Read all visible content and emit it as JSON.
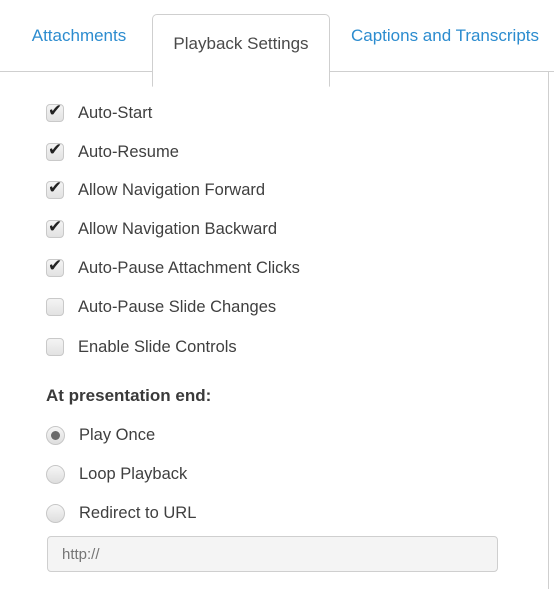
{
  "tabs": [
    {
      "label": "Attachments",
      "active": false
    },
    {
      "label": "Playback Settings",
      "active": true
    },
    {
      "label": "Captions and Transcripts",
      "active": false
    }
  ],
  "options": [
    {
      "label": "Auto-Start",
      "checked": true
    },
    {
      "label": "Auto-Resume",
      "checked": true
    },
    {
      "label": "Allow Navigation Forward",
      "checked": true
    },
    {
      "label": "Allow Navigation Backward",
      "checked": true
    },
    {
      "label": "Auto-Pause Attachment Clicks",
      "checked": true
    },
    {
      "label": "Auto-Pause Slide Changes",
      "checked": false
    },
    {
      "label": "Enable Slide Controls",
      "checked": false
    }
  ],
  "presentation_end": {
    "title": "At presentation end:",
    "choices": [
      {
        "label": "Play Once",
        "selected": true
      },
      {
        "label": "Loop Playback",
        "selected": false
      },
      {
        "label": "Redirect to URL",
        "selected": false
      }
    ],
    "url_placeholder": "http://",
    "url_value": ""
  },
  "icons": {
    "checkbox_check": "✔"
  },
  "colors": {
    "tab_link": "#2c8ccf",
    "text": "#3f3f3f",
    "border": "#cfcfcf"
  }
}
